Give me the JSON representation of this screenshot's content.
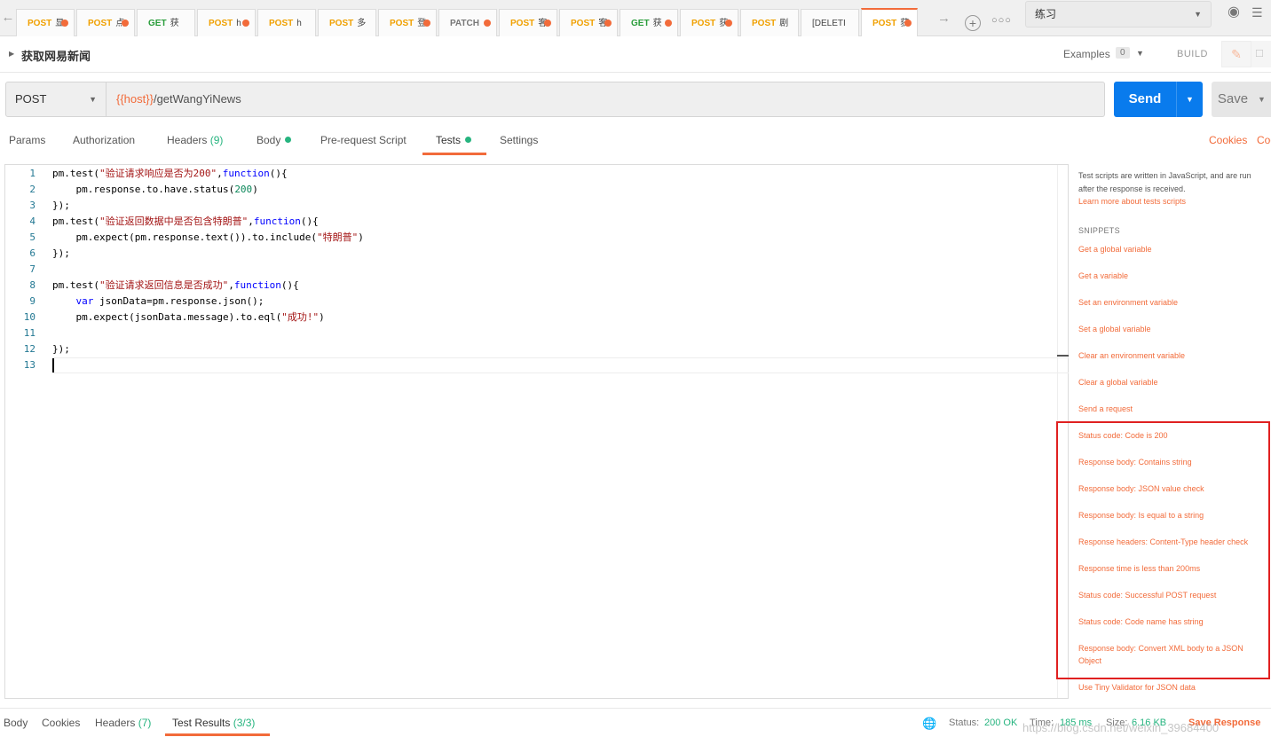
{
  "tabs": [
    {
      "method": "POST",
      "name": "显",
      "method_color": "#f0a000",
      "dot": true,
      "active": false
    },
    {
      "method": "POST",
      "name": "点",
      "method_color": "#f0a000",
      "dot": true,
      "active": false
    },
    {
      "method": "GET",
      "name": "获",
      "method_color": "#2a9d3b",
      "dot": false,
      "active": false
    },
    {
      "method": "POST",
      "name": "h",
      "method_color": "#f0a000",
      "dot": true,
      "active": false
    },
    {
      "method": "POST",
      "name": "h",
      "method_color": "#f0a000",
      "dot": false,
      "active": false
    },
    {
      "method": "POST",
      "name": "多",
      "method_color": "#f0a000",
      "dot": false,
      "active": false
    },
    {
      "method": "POST",
      "name": "登",
      "method_color": "#f0a000",
      "dot": true,
      "active": false
    },
    {
      "method": "PATCH",
      "name": "",
      "method_color": "#777777",
      "dot": true,
      "active": false
    },
    {
      "method": "POST",
      "name": "客",
      "method_color": "#f0a000",
      "dot": true,
      "active": false
    },
    {
      "method": "POST",
      "name": "客",
      "method_color": "#f0a000",
      "dot": true,
      "active": false
    },
    {
      "method": "GET",
      "name": "获",
      "method_color": "#2a9d3b",
      "dot": true,
      "active": false
    },
    {
      "method": "POST",
      "name": "获",
      "method_color": "#f0a000",
      "dot": true,
      "active": false
    },
    {
      "method": "POST",
      "name": "剧",
      "method_color": "#f0a000",
      "dot": false,
      "active": false
    },
    {
      "method": "[DELETI",
      "name": "",
      "method_color": "#444444",
      "dot": false,
      "active": false
    },
    {
      "method": "POST",
      "name": "获",
      "method_color": "#f0a000",
      "dot": true,
      "active": true
    }
  ],
  "icons": {
    "back": "arrow-left-icon",
    "forward": "arrow-right-icon",
    "add": "plus-circle-icon",
    "more": "more-icon",
    "eye": "eye-icon",
    "settings": "sliders-icon",
    "edit": "pencil-icon",
    "comment": "comment-icon",
    "globe": "globe-icon"
  },
  "environment": {
    "selected": "练习"
  },
  "request": {
    "name": "获取网易新闻",
    "method": "POST",
    "url_variable": "{{host}}",
    "url_path": "/getWangYiNews"
  },
  "header": {
    "examples_label": "Examples",
    "examples_count": "0",
    "build_label": "BUILD"
  },
  "buttons": {
    "send": "Send",
    "save": "Save"
  },
  "request_tabs": [
    {
      "label": "Params",
      "count": "",
      "dot": false
    },
    {
      "label": "Authorization",
      "count": "",
      "dot": false
    },
    {
      "label": "Headers",
      "count": "(9)",
      "dot": false
    },
    {
      "label": "Body",
      "count": "",
      "dot": true
    },
    {
      "label": "Pre-request Script",
      "count": "",
      "dot": false
    },
    {
      "label": "Tests",
      "count": "",
      "dot": true
    },
    {
      "label": "Settings",
      "count": "",
      "dot": false
    }
  ],
  "links": {
    "cookies": "Cookies",
    "code": "Code"
  },
  "editor": {
    "lines": [
      {
        "n": "1",
        "parts": [
          {
            "t": "pm.test(",
            "c": ""
          },
          {
            "t": "\"验证请求响应是否为200\"",
            "c": "str"
          },
          {
            "t": ",",
            "c": ""
          },
          {
            "t": "function",
            "c": "kw"
          },
          {
            "t": "(){",
            "c": ""
          }
        ]
      },
      {
        "n": "2",
        "parts": [
          {
            "t": "    pm.response.to.have.status(",
            "c": ""
          },
          {
            "t": "200",
            "c": "num"
          },
          {
            "t": ")",
            "c": ""
          }
        ]
      },
      {
        "n": "3",
        "parts": [
          {
            "t": "});",
            "c": ""
          }
        ]
      },
      {
        "n": "4",
        "parts": [
          {
            "t": "pm.test(",
            "c": ""
          },
          {
            "t": "\"验证返回数据中是否包含特朗普\"",
            "c": "str"
          },
          {
            "t": ",",
            "c": ""
          },
          {
            "t": "function",
            "c": "kw"
          },
          {
            "t": "(){",
            "c": ""
          }
        ]
      },
      {
        "n": "5",
        "parts": [
          {
            "t": "    pm.expect(pm.response.text()).to.include(",
            "c": ""
          },
          {
            "t": "\"特朗普\"",
            "c": "str"
          },
          {
            "t": ")",
            "c": ""
          }
        ]
      },
      {
        "n": "6",
        "parts": [
          {
            "t": "});",
            "c": ""
          }
        ]
      },
      {
        "n": "7",
        "parts": []
      },
      {
        "n": "8",
        "parts": [
          {
            "t": "pm.test(",
            "c": ""
          },
          {
            "t": "\"验证请求返回信息是否成功\"",
            "c": "str"
          },
          {
            "t": ",",
            "c": ""
          },
          {
            "t": "function",
            "c": "kw"
          },
          {
            "t": "(){",
            "c": ""
          }
        ]
      },
      {
        "n": "9",
        "parts": [
          {
            "t": "    ",
            "c": ""
          },
          {
            "t": "var",
            "c": "kw"
          },
          {
            "t": " jsonData=pm.response.json();",
            "c": ""
          }
        ]
      },
      {
        "n": "10",
        "parts": [
          {
            "t": "    pm.expect(jsonData.message).to.eql(",
            "c": ""
          },
          {
            "t": "\"成功!\"",
            "c": "str"
          },
          {
            "t": ")",
            "c": ""
          }
        ]
      },
      {
        "n": "11",
        "parts": []
      },
      {
        "n": "12",
        "parts": [
          {
            "t": "});",
            "c": ""
          }
        ]
      },
      {
        "n": "13",
        "parts": []
      }
    ]
  },
  "snippets_panel": {
    "description": "Test scripts are written in JavaScript, and are run after the response is received.",
    "learn_more": "Learn more about tests scripts",
    "header": "SNIPPETS",
    "items": [
      "Get a global variable",
      "Get a variable",
      "Set an environment variable",
      "Set a global variable",
      "Clear an environment variable",
      "Clear a global variable",
      "Send a request",
      "Status code: Code is 200",
      "Response body: Contains string",
      "Response body: JSON value check",
      "Response body: Is equal to a string",
      "Response headers: Content-Type header check",
      "Response time is less than 200ms",
      "Status code: Successful POST request",
      "Status code: Code name has string",
      "Response body: Convert XML body to a JSON Object",
      "Use Tiny Validator for JSON data"
    ]
  },
  "response_tabs": [
    {
      "label": "Body",
      "count": ""
    },
    {
      "label": "Cookies",
      "count": ""
    },
    {
      "label": "Headers",
      "count": "(7)"
    },
    {
      "label": "Test Results",
      "count": "(3/3)"
    }
  ],
  "status": {
    "status_label": "Status:",
    "status_value": "200 OK",
    "time_label": "Time:",
    "time_value": "185 ms",
    "size_label": "Size:",
    "size_value": "6.16 KB",
    "save_response": "Save Response"
  },
  "watermark": "https://blog.csdn.net/weixin_39684400"
}
